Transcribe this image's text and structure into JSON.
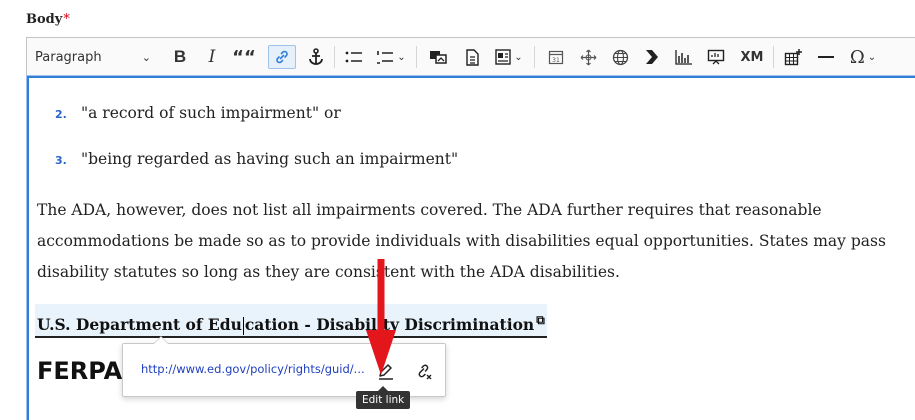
{
  "field": {
    "label": "Body",
    "required_marker": "*"
  },
  "toolbar": {
    "heading_select": "Paragraph",
    "buttons": {
      "bold": "B",
      "italic": "I",
      "blockquote": "““",
      "source": "XM",
      "special_chars": "Ω"
    }
  },
  "content": {
    "list_items": [
      {
        "number": "2.",
        "text": "\"a record of such impairment\" or"
      },
      {
        "number": "3.",
        "text": "\"being regarded as having such an impairment\""
      }
    ],
    "paragraph": "The ADA, however, does not list all impairments covered. The ADA further requires that reasonable accommodations be made so as to provide individuals with disabilities equal opportunities. States may pass disability statutes so long as they are consistent with the ADA disabilities.",
    "link_text_before_caret": "U.S. Department of Edu",
    "link_text_after_caret": "cation - Disability Discrimination",
    "heading": "FERPA"
  },
  "link_balloon": {
    "url": "http://www.ed.gov/policy/rights/guid/...",
    "tooltip": "Edit link"
  },
  "colors": {
    "accent": "#2f7ed8",
    "annotation_arrow": "#e3161b"
  }
}
